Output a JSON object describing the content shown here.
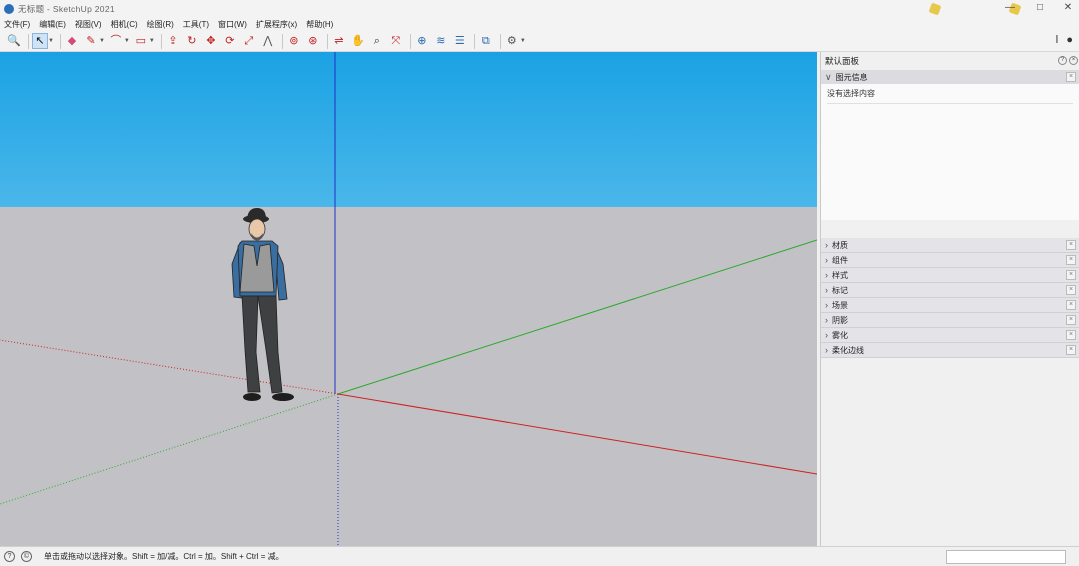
{
  "window": {
    "title": "无标题 - SketchUp 2021",
    "controls": {
      "minimize": "—",
      "maximize": "□",
      "close": "✕"
    }
  },
  "menu": [
    "文件(F)",
    "编辑(E)",
    "视图(V)",
    "相机(C)",
    "绘图(R)",
    "工具(T)",
    "窗口(W)",
    "扩展程序(x)",
    "帮助(H)"
  ],
  "toolbar": {
    "tools": [
      {
        "icon": "zoom-icon",
        "glyph": "🔍"
      },
      {
        "icon": "select-arrow-icon",
        "glyph": "↖",
        "active": true
      },
      {
        "icon": "eraser-icon",
        "glyph": "◆"
      },
      {
        "icon": "pencil-icon",
        "glyph": "✎"
      },
      {
        "icon": "arc-icon",
        "glyph": "⌒"
      },
      {
        "icon": "rectangle-icon",
        "glyph": "▭"
      },
      {
        "icon": "push-pull-icon",
        "glyph": "⇪"
      },
      {
        "icon": "follow-me-icon",
        "glyph": "↻"
      },
      {
        "icon": "move-icon",
        "glyph": "✥"
      },
      {
        "icon": "rotate-icon",
        "glyph": "⟳"
      },
      {
        "icon": "scale-icon",
        "glyph": "⤢"
      },
      {
        "icon": "offset-icon",
        "glyph": "⋀"
      },
      {
        "icon": "tape-measure-icon",
        "glyph": "⊚"
      },
      {
        "icon": "orbit-icon",
        "glyph": "⊛"
      },
      {
        "icon": "paint-bucket-icon",
        "glyph": "⇌"
      },
      {
        "icon": "pan-icon",
        "glyph": "✋"
      },
      {
        "icon": "zoom-tool-icon",
        "glyph": "⌕"
      },
      {
        "icon": "zoom-extents-icon",
        "glyph": "⤧"
      },
      {
        "icon": "warehouse-icon",
        "glyph": "⊕"
      },
      {
        "icon": "components-icon",
        "glyph": "≋"
      },
      {
        "icon": "layers-icon",
        "glyph": "☰"
      },
      {
        "icon": "extension-icon",
        "glyph": "⧉"
      },
      {
        "icon": "settings-icon",
        "glyph": "⚙"
      }
    ],
    "right": [
      {
        "icon": "info-icon",
        "glyph": "ǀ"
      },
      {
        "icon": "user-icon",
        "glyph": "●"
      }
    ]
  },
  "colors": {
    "sky_top": "#1ba2e4",
    "ground": "#c2c2c6",
    "axis_red": "#d02020",
    "axis_green": "#2aa82a",
    "axis_blue": "#2030c8"
  },
  "tray": {
    "title": "默认面板",
    "title_buttons": [
      "?",
      "×"
    ],
    "entity_info": {
      "label": "图元信息",
      "empty_text": "没有选择内容"
    },
    "panels": [
      {
        "label": "材质"
      },
      {
        "label": "组件"
      },
      {
        "label": "样式"
      },
      {
        "label": "标记"
      },
      {
        "label": "场景"
      },
      {
        "label": "阴影"
      },
      {
        "label": "雾化"
      },
      {
        "label": "柔化边线"
      }
    ],
    "close_glyph": "×"
  },
  "status": {
    "icons": [
      {
        "icon": "geo-location-icon",
        "glyph": "?"
      },
      {
        "icon": "credits-icon",
        "glyph": "©"
      }
    ],
    "text": "单击或拖动以选择对象。Shift = 加/减。Ctrl = 加。Shift + Ctrl = 减。",
    "measure_value": ""
  }
}
